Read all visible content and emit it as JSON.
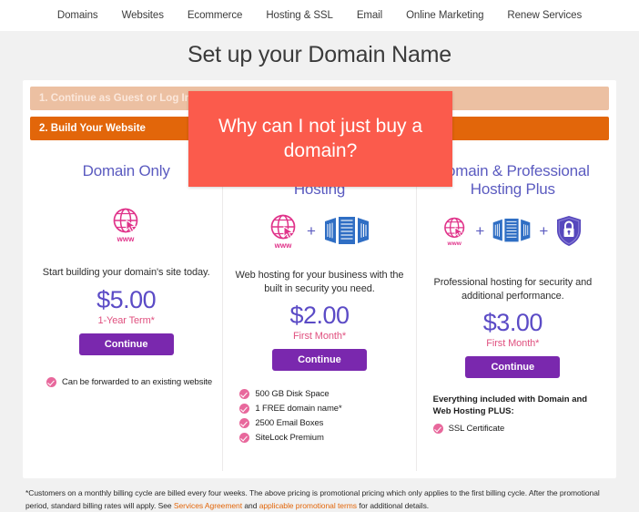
{
  "nav": {
    "items": [
      {
        "label": "Domains"
      },
      {
        "label": "Websites"
      },
      {
        "label": "Ecommerce"
      },
      {
        "label": "Hosting & SSL"
      },
      {
        "label": "Email"
      },
      {
        "label": "Online Marketing"
      },
      {
        "label": "Renew Services"
      }
    ]
  },
  "page": {
    "title": "Set up your Domain Name"
  },
  "steps": [
    {
      "label": "1. Continue as Guest or Log In",
      "state": "inactive",
      "color": "#ecc0a2"
    },
    {
      "label": "2. Build Your Website",
      "state": "active",
      "color": "#e2660a"
    }
  ],
  "cards": [
    {
      "title": "Domain Only",
      "icons": [
        "globe-www-icon"
      ],
      "description": "Start building your domain's site today.",
      "price": "$5.00",
      "term": "1-Year Term*",
      "button_label": "Continue",
      "features_heading": "",
      "features": [
        "Can be forwarded to an existing website"
      ]
    },
    {
      "title": "Domain & Professional Hosting",
      "icons": [
        "globe-www-icon",
        "plus-sign",
        "server-rack-icon"
      ],
      "description": "Web hosting for your business with the built in security you need.",
      "price": "$2.00",
      "term": "First Month*",
      "button_label": "Continue",
      "features_heading": "",
      "features": [
        "500 GB Disk Space",
        "1 FREE domain name*",
        "2500 Email Boxes",
        "SiteLock Premium"
      ]
    },
    {
      "title": "Domain & Professional Hosting Plus",
      "icons": [
        "globe-www-icon",
        "plus-sign",
        "server-rack-icon",
        "plus-sign",
        "shield-lock-icon"
      ],
      "description": "Professional hosting for security and additional performance.",
      "price": "$3.00",
      "term": "First Month*",
      "button_label": "Continue",
      "features_heading": "Everything included with Domain and Web Hosting PLUS:",
      "features": [
        "SSL Certificate"
      ]
    }
  ],
  "footnote": {
    "part1": "*Customers on a monthly billing cycle are billed every four weeks. The above pricing is promotional pricing which only applies to the first billing cycle. After the promotional period, standard billing rates will apply. See ",
    "link1": "Services Agreement",
    "part2": " and ",
    "link2": "applicable promotional terms",
    "part3": " for additional details."
  },
  "overlay": {
    "text": "Why can I not just buy a domain?",
    "color": "#fb5b4c"
  },
  "colors": {
    "accent_orange": "#e2660a",
    "title_purple": "#5b5bc0",
    "price_purple": "#5b4bc6",
    "pink": "#e0507f",
    "button_purple": "#7a28ae",
    "globe_pink": "#e0338a",
    "server_blue": "#2f6ec4",
    "shield_purple": "#5647bd"
  }
}
